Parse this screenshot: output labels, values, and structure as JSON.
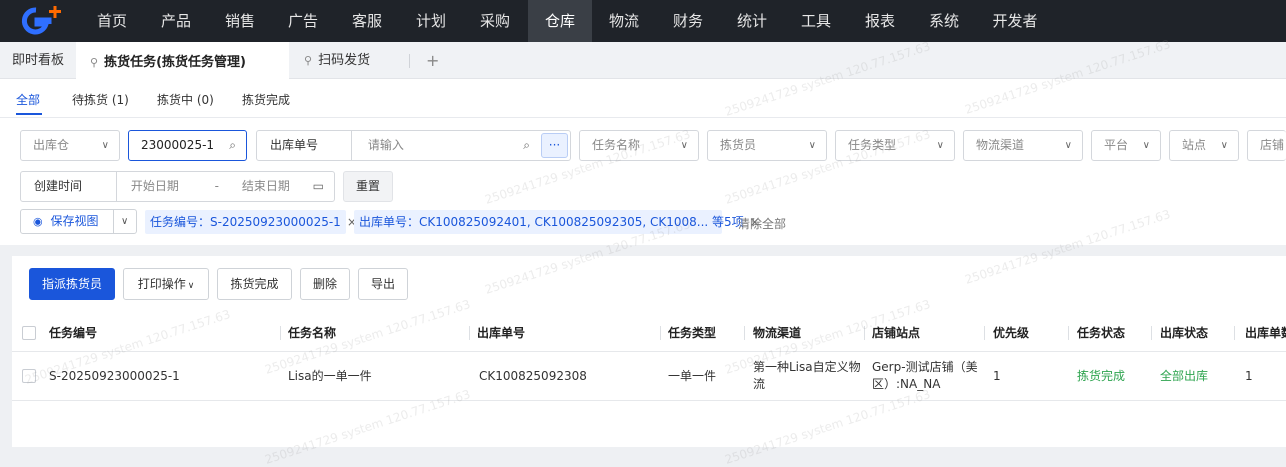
{
  "nav": {
    "items": [
      "首页",
      "产品",
      "销售",
      "广告",
      "客服",
      "计划",
      "采购",
      "仓库",
      "物流",
      "财务",
      "统计",
      "工具",
      "报表",
      "系统",
      "开发者"
    ],
    "active": "仓库"
  },
  "tabs": {
    "items": [
      "即时看板",
      "拣货任务(拣货任务管理)",
      "扫码发货"
    ],
    "add": "+"
  },
  "subtabs": [
    "全部",
    "待拣货 (1)",
    "拣货中 (0)",
    "拣货完成"
  ],
  "filters": {
    "warehouse": "出库仓",
    "task_no_value": "23000025-1",
    "outbound_label": "出库单号",
    "outbound_placeholder": "请输入",
    "more": "···",
    "task_name": "任务名称",
    "picker": "拣货员",
    "task_type": "任务类型",
    "logistics": "物流渠道",
    "platform": "平台",
    "site": "站点",
    "store": "店铺",
    "created_label": "创建时间",
    "start_date": "开始日期",
    "date_sep": "-",
    "end_date": "结束日期",
    "reset": "重置"
  },
  "view": {
    "save": "保存视图",
    "chip1": "任务编号：S-20250923000025-1",
    "chip2": "出库单号：CK100825092401, CK100825092305, CK1008... 等5项",
    "clear_all": "清除全部"
  },
  "actions": [
    "指派拣货员",
    "打印操作",
    "拣货完成",
    "删除",
    "导出"
  ],
  "table": {
    "headers": [
      "任务编号",
      "任务名称",
      "出库单号",
      "任务类型",
      "物流渠道",
      "店铺站点",
      "优先级",
      "任务状态",
      "出库状态",
      "出库单数"
    ],
    "rows": [
      {
        "task_no": "S-20250923000025-1",
        "task_name": "Lisa的一单一件",
        "outbound_no": "CK100825092308",
        "task_type": "一单一件",
        "logistics_1": "第一种Lisa自定义物",
        "logistics_2": "流",
        "store_1": "Gerp-测试店铺（美",
        "store_2": "区）:NA_NA",
        "priority": "1",
        "task_status": "拣货完成",
        "out_status": "全部出库",
        "out_count": "1"
      }
    ]
  },
  "watermark": "2509241729 system 120.77.157.63",
  "colors": {
    "primary": "#1a56db",
    "nav_bg": "#1f2329",
    "success": "#2ea44f",
    "logo_orange": "#ff6a00"
  }
}
